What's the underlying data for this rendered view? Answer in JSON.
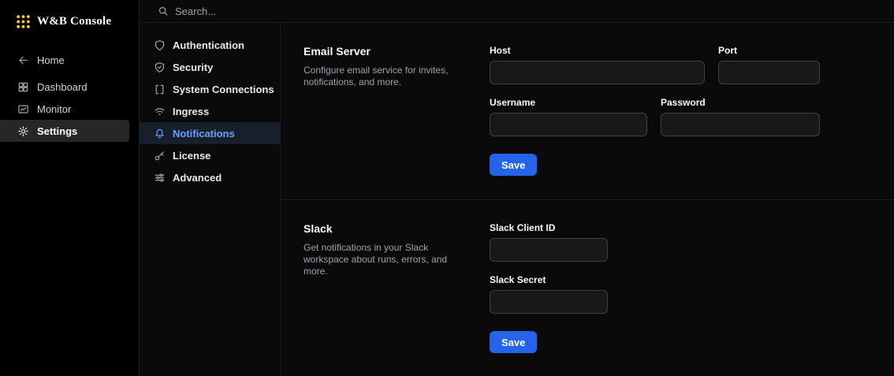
{
  "brand": {
    "title": "W&B Console"
  },
  "search": {
    "placeholder": "Search..."
  },
  "sidebar": {
    "items": [
      {
        "label": "Home",
        "icon": "arrow-left",
        "selected": false
      },
      {
        "label": "Dashboard",
        "icon": "grid",
        "selected": false
      },
      {
        "label": "Monitor",
        "icon": "monitor-chart",
        "selected": false
      },
      {
        "label": "Settings",
        "icon": "gear",
        "selected": true
      }
    ]
  },
  "settings_nav": {
    "items": [
      {
        "label": "Authentication",
        "icon": "shield",
        "selected": false
      },
      {
        "label": "Security",
        "icon": "shield-check",
        "selected": false
      },
      {
        "label": "System Connections",
        "icon": "brackets",
        "selected": false
      },
      {
        "label": "Ingress",
        "icon": "wifi",
        "selected": false
      },
      {
        "label": "Notifications",
        "icon": "bell",
        "selected": true
      },
      {
        "label": "License",
        "icon": "key",
        "selected": false
      },
      {
        "label": "Advanced",
        "icon": "sliders",
        "selected": false
      }
    ]
  },
  "sections": [
    {
      "title": "Email Server",
      "description": "Configure email service for invites, notifications, and more.",
      "fields": {
        "host": {
          "label": "Host",
          "value": ""
        },
        "port": {
          "label": "Port",
          "value": ""
        },
        "username": {
          "label": "Username",
          "value": ""
        },
        "password": {
          "label": "Password",
          "value": ""
        }
      },
      "save_label": "Save"
    },
    {
      "title": "Slack",
      "description": "Get notifications in your Slack workspace about runs, errors, and more.",
      "fields": {
        "client_id": {
          "label": "Slack Client ID",
          "value": ""
        },
        "secret": {
          "label": "Slack Secret",
          "value": ""
        }
      },
      "save_label": "Save"
    }
  ],
  "colors": {
    "accent_blue": "#2563eb",
    "selected_text_blue": "#60a5fa",
    "brand_yellow": "#ffcc33",
    "background": "#0a0a0a",
    "sidebar_background": "#000000"
  }
}
